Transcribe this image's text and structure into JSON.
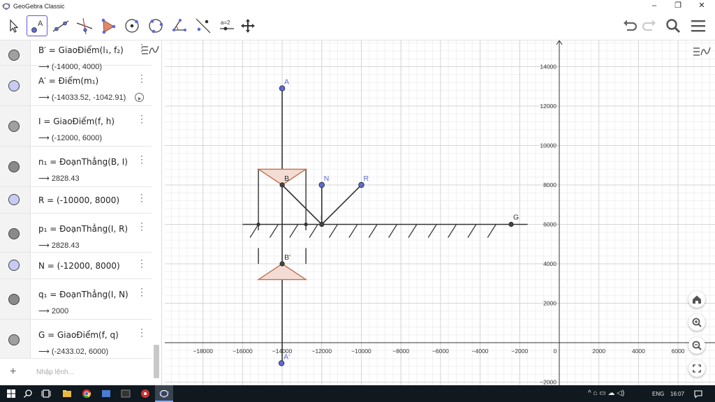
{
  "window": {
    "title": "GeoGebra Classic"
  },
  "toolbar": {
    "tools": [
      {
        "name": "move-tool"
      },
      {
        "name": "point-tool"
      },
      {
        "name": "line-tool"
      },
      {
        "name": "perpendicular-line-tool"
      },
      {
        "name": "polygon-tool"
      },
      {
        "name": "circle-tool"
      },
      {
        "name": "circle-three-points-tool"
      },
      {
        "name": "angle-tool"
      },
      {
        "name": "reflect-tool"
      },
      {
        "name": "slider-tool",
        "label": "a=2"
      },
      {
        "name": "move-graphics-tool"
      }
    ],
    "active_tool": "point-tool"
  },
  "algebra": {
    "items": [
      {
        "defn": "B′ = GiaoĐiểm(l₁, f₂)",
        "value": "⟶ (-14000, 4000)",
        "color": "#a0a0a0"
      },
      {
        "defn": "A′ = Điểm(m₁)",
        "value": "⟶ (-14033.52, -1042.91)",
        "color": "#c8ccf5"
      },
      {
        "defn": "I = GiaoĐiểm(f, h)",
        "value": "⟶ (-12000, 6000)",
        "color": "#a0a0a0"
      },
      {
        "defn": "n₁ = ĐoạnThẳng(B, I)",
        "value": "⟶ 2828.43",
        "color": "#8a8a8a"
      },
      {
        "defn": "R = (-10000, 8000)",
        "value": "",
        "color": "#c8ccf5"
      },
      {
        "defn": "p₁ = ĐoạnThẳng(I, R)",
        "value": "⟶ 2828.43",
        "color": "#8a8a8a"
      },
      {
        "defn": "N = (-12000, 8000)",
        "value": "",
        "color": "#c8ccf5"
      },
      {
        "defn": "q₁ = ĐoạnThẳng(I, N)",
        "value": "⟶ 2000",
        "color": "#8a8a8a"
      },
      {
        "defn": "G = GiaoĐiểm(f, q)",
        "value": "⟶ (-2433.02, 6000)",
        "color": "#a0a0a0"
      }
    ],
    "input_placeholder": "Nhập lệnh..."
  },
  "graphics": {
    "x_ticks": [
      "−18000",
      "−16000",
      "−14000",
      "−12000",
      "−10000",
      "−8000",
      "−6000",
      "−4000",
      "−2000",
      "0",
      "2000",
      "4000",
      "6000"
    ],
    "y_ticks": [
      "14000",
      "12000",
      "10000",
      "8000",
      "6000",
      "4000",
      "2000",
      "−2000"
    ],
    "points": [
      {
        "label": "A",
        "x": -14000,
        "y": 12900
      },
      {
        "label": "B",
        "x": -14000,
        "y": 8000
      },
      {
        "label": "N",
        "x": -12000,
        "y": 8000
      },
      {
        "label": "R",
        "x": -10000,
        "y": 8000
      },
      {
        "label": "I",
        "x": -12000,
        "y": 6000
      },
      {
        "label": "G",
        "x": -2433.02,
        "y": 6000
      },
      {
        "label": "B'",
        "x": -14000,
        "y": 4000
      },
      {
        "label": "A'",
        "x": -14033.52,
        "y": -1042.91
      }
    ],
    "colors": {
      "free_point": "#5e6ad8",
      "dependent_point": "#444444",
      "triangle_fill": "#f3dcd4",
      "triangle_stroke": "#c0704e"
    }
  },
  "taskbar": {
    "language": "ENG",
    "time": "16:07"
  }
}
